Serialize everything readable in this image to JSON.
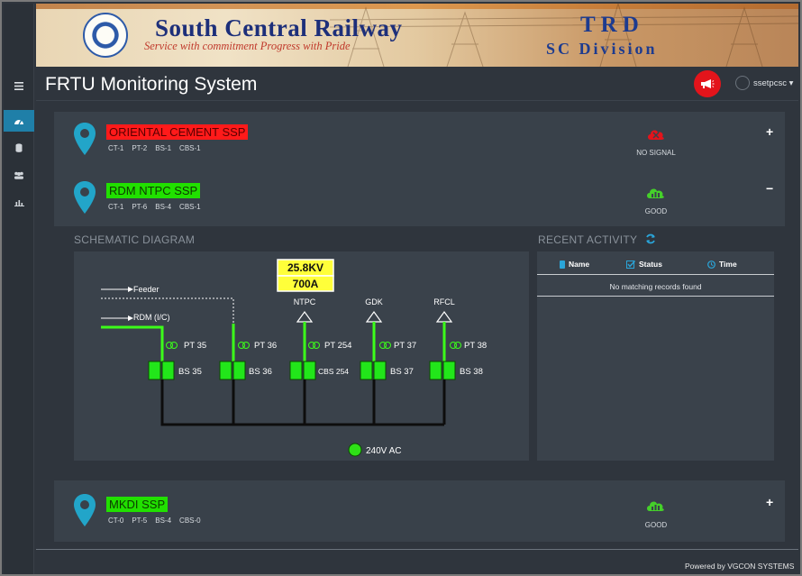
{
  "banner": {
    "title": "South Central Railway",
    "subtitle": "Service with commitment Progress with Pride",
    "trd": "TRD",
    "division": "SC Division"
  },
  "header": {
    "app_title": "FRTU Monitoring System",
    "user_name": "ssetpcsc ▾"
  },
  "substations": [
    {
      "name": "ORIENTAL CEMENT SSP",
      "status_color": "#ff1a1a",
      "counts": [
        "CT-1",
        "PT-2",
        "BS-1",
        "CBS-1"
      ],
      "signal": "NO SIGNAL",
      "toggle": "+"
    },
    {
      "name": "RDM NTPC SSP",
      "status_color": "#21e000",
      "counts": [
        "CT-1",
        "PT-6",
        "BS-4",
        "CBS-1"
      ],
      "signal": "GOOD",
      "toggle": "−"
    },
    {
      "name": "MKDI SSP",
      "status_color": "#21e000",
      "counts": [
        "CT-0",
        "PT-5",
        "BS-4",
        "CBS-0"
      ],
      "signal": "GOOD",
      "toggle": "+"
    }
  ],
  "schematic": {
    "title": "SCHEMATIC DIAGRAM",
    "voltage": "25.8KV",
    "current": "700A",
    "feeder_label": "Feeder",
    "incomer_label": "RDM (I/C)",
    "supply_label": "240V AC",
    "bays": [
      {
        "line": "",
        "pt": "PT 35",
        "bs": "BS 35"
      },
      {
        "line": "",
        "pt": "PT 36",
        "bs": "BS 36"
      },
      {
        "line": "NTPC",
        "pt": "PT 254",
        "bs": "CBS 254"
      },
      {
        "line": "GDK",
        "pt": "PT 37",
        "bs": "BS 37"
      },
      {
        "line": "RFCL",
        "pt": "PT 38",
        "bs": "BS 38"
      }
    ]
  },
  "recent": {
    "title": "RECENT ACTIVITY",
    "columns": [
      "Name",
      "Status",
      "Time"
    ],
    "empty_text": "No matching records found"
  },
  "footer": {
    "powered_by": "Powered by VGCON SYSTEMS"
  },
  "colors": {
    "accent": "#1f7fa8",
    "pin": "#22a5c9",
    "live": "#21e000",
    "alarm": "#e3141b"
  }
}
